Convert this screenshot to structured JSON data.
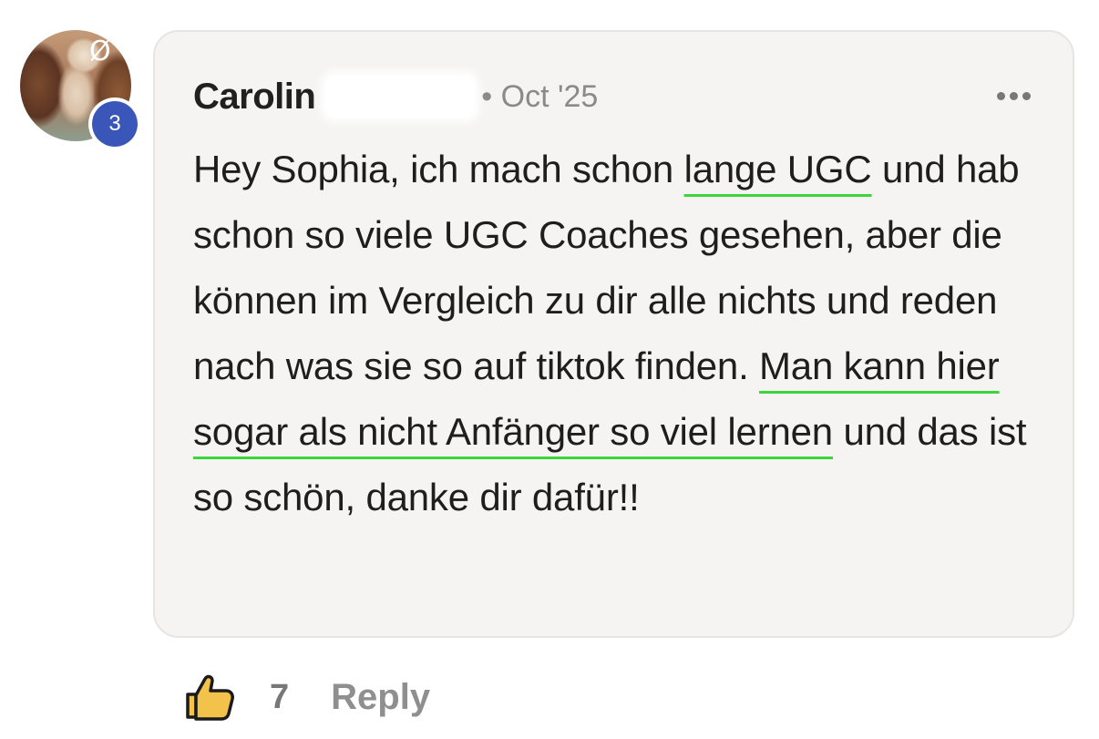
{
  "comment": {
    "avatar_badge": "3",
    "author": "Carolin",
    "date": "• Oct '25",
    "more_icon": "more-horizontal-icon",
    "text_segments": [
      "Hey Sophia, ich mach schon ",
      "lange UGC",
      " und hab schon so viele UGC Coaches gesehen, aber die können im Vergleich zu dir alle nichts und reden nach was sie so auf tiktok finden. ",
      "Man kann hier sogar als nicht Anfänger so viel lernen",
      " und das ist so schön, danke dir dafür!!"
    ],
    "highlight_color": "#3ad63a",
    "badge_color": "#3b56b9"
  },
  "footer": {
    "like_icon": "thumbs-up-icon",
    "like_count": "7",
    "reply_label": "Reply"
  }
}
